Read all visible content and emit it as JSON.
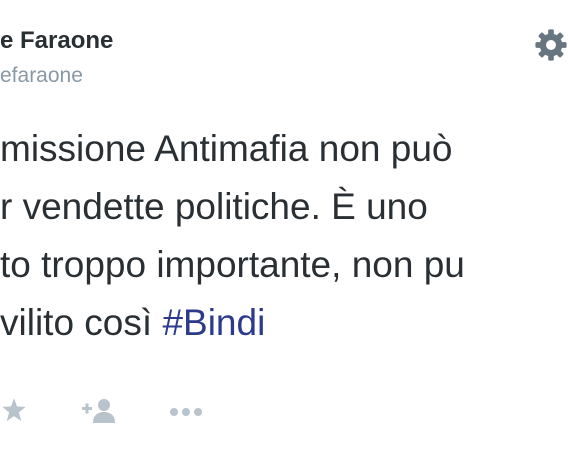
{
  "header": {
    "display_name": "e Faraone",
    "handle": "efaraone",
    "settings_icon": "gear-icon"
  },
  "tweet": {
    "lines": [
      "missione Antimafia non può",
      "r vendette politiche. È uno",
      "to troppo importante, non pu",
      "vilito così "
    ],
    "hashtag": "#Bindi"
  },
  "actions": {
    "icons": [
      "star-icon",
      "follow-icon",
      "more-icon"
    ]
  },
  "colors": {
    "text": "#292f33",
    "muted": "#8899a6",
    "hashtag": "#2b3a8c",
    "icon": "#b8c3cc"
  }
}
